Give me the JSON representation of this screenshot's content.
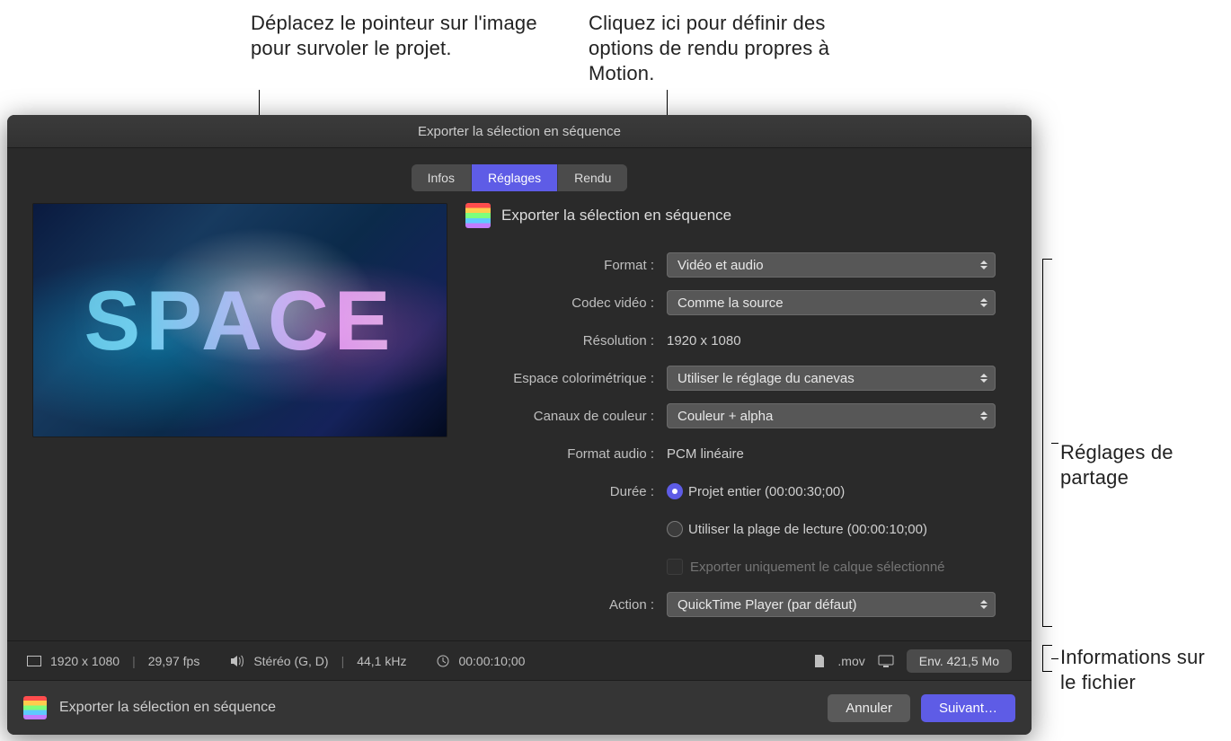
{
  "callouts": {
    "preview_hover": "Déplacez le pointeur sur l'image pour survoler le projet.",
    "render_tab": "Cliquez ici pour définir des options de rendu propres à Motion.",
    "share_settings": "Réglages de partage",
    "file_info": "Informations sur le fichier"
  },
  "window": {
    "title": "Exporter la sélection en séquence"
  },
  "tabs": {
    "infos": "Infos",
    "reglages": "Réglages",
    "rendu": "Rendu"
  },
  "preview": {
    "text": "SPACE"
  },
  "section": {
    "title": "Exporter la sélection en séquence"
  },
  "settings": {
    "format": {
      "label": "Format :",
      "value": "Vidéo et audio"
    },
    "codec": {
      "label": "Codec vidéo :",
      "value": "Comme la source"
    },
    "resolution": {
      "label": "Résolution :",
      "value": "1920 x 1080"
    },
    "colorspace": {
      "label": "Espace colorimétrique :",
      "value": "Utiliser le réglage du canevas"
    },
    "colorchannels": {
      "label": "Canaux de couleur :",
      "value": "Couleur + alpha"
    },
    "audioformat": {
      "label": "Format audio :",
      "value": "PCM linéaire"
    },
    "duration": {
      "label": "Durée :",
      "opt1": "Projet entier (00:00:30;00)",
      "opt2": "Utiliser la plage de lecture (00:00:10;00)"
    },
    "export_layer": {
      "label": "Exporter uniquement le calque sélectionné"
    },
    "action": {
      "label": "Action :",
      "value": "QuickTime Player (par défaut)"
    }
  },
  "status": {
    "dimensions": "1920 x 1080",
    "fps": "29,97 fps",
    "audio": "Stéréo (G, D)",
    "samplerate": "44,1 kHz",
    "duration": "00:00:10;00",
    "extension": ".mov",
    "size_estimate": "Env. 421,5 Mo"
  },
  "footer": {
    "title": "Exporter la sélection en séquence",
    "cancel": "Annuler",
    "next": "Suivant…"
  }
}
